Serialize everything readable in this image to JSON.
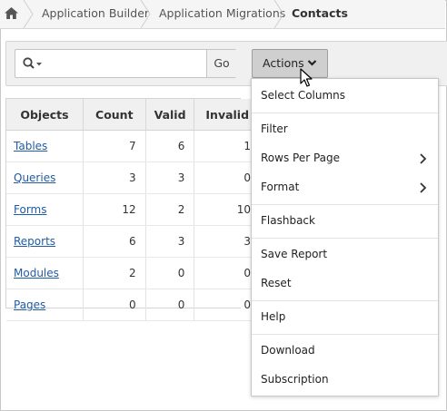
{
  "breadcrumb": {
    "home_icon": "home-icon",
    "items": [
      "Application Builder",
      "Application Migrations"
    ],
    "current": "Contacts"
  },
  "toolbar": {
    "search_placeholder": "",
    "go_label": "Go",
    "actions_label": "Actions"
  },
  "table": {
    "headers": [
      "Objects",
      "Count",
      "Valid",
      "Invalid"
    ],
    "rows": [
      {
        "object": "Tables",
        "count": "7",
        "valid": "6",
        "invalid": "1"
      },
      {
        "object": "Queries",
        "count": "3",
        "valid": "3",
        "invalid": "0"
      },
      {
        "object": "Forms",
        "count": "12",
        "valid": "2",
        "invalid": "10"
      },
      {
        "object": "Reports",
        "count": "6",
        "valid": "3",
        "invalid": "3"
      },
      {
        "object": "Modules",
        "count": "2",
        "valid": "0",
        "invalid": "0"
      },
      {
        "object": "Pages",
        "count": "0",
        "valid": "0",
        "invalid": "0"
      }
    ]
  },
  "menu": {
    "select_columns": "Select Columns",
    "filter": "Filter",
    "rows_per_page": "Rows Per Page",
    "format": "Format",
    "flashback": "Flashback",
    "save_report": "Save Report",
    "reset": "Reset",
    "help": "Help",
    "download": "Download",
    "subscription": "Subscription"
  },
  "colors": {
    "link": "#205ba5",
    "actions_bg": "#cfcfcf",
    "toolbar_bg": "#f0f0f0"
  }
}
